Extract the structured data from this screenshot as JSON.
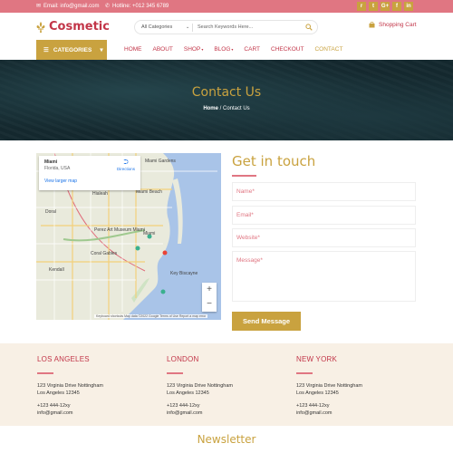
{
  "topbar": {
    "email": "Email: info@gmail.com",
    "hotline": "Hotline: +012 345 6789",
    "social_icons": [
      "rss-icon",
      "twitter-icon",
      "google-plus-icon",
      "facebook-icon",
      "linkedin-icon"
    ],
    "social_glyphs": [
      "r",
      "t",
      "G+",
      "f",
      "in"
    ]
  },
  "brand": {
    "name": "Cosmetic"
  },
  "search": {
    "category": "All Categories",
    "placeholder": "Search Keywords Here..."
  },
  "cart": {
    "label": "Shopping Cart"
  },
  "categories_button": {
    "label": "CATEGORIES"
  },
  "nav": {
    "home": "HOME",
    "about": "ABOUT",
    "shop": "SHOP",
    "blog": "BLOG",
    "cart": "CART",
    "checkout": "CHECKOUT",
    "contact": "CONTACT"
  },
  "hero": {
    "title": "Contact Us",
    "crumb_home": "Home",
    "crumb_sep": "/",
    "crumb_current": "Contact Us"
  },
  "map": {
    "place_name": "Miami",
    "place_sub": "Florida, USA",
    "view_larger": "View larger map",
    "directions": "Directions",
    "zoom_in": "+",
    "zoom_out": "−",
    "footer": "Keyboard shortcuts   Map data ©2022 Google   Terms of Use   Report a map error",
    "labels": [
      "Hialeah",
      "Miami Beach",
      "Miami",
      "Coral Gables",
      "Perez Art Museum Miami",
      "Key Biscayne",
      "Miami Gardens",
      "Doral",
      "Kendall"
    ]
  },
  "contact_form": {
    "title": "Get in touch",
    "name_placeholder": "Name*",
    "email_placeholder": "Email*",
    "website_placeholder": "Website*",
    "message_placeholder": "Message*",
    "send_label": "Send Message"
  },
  "offices": [
    {
      "city": "LOS ANGELES",
      "address1": "123 Virginia Drive Nottingham",
      "address2": "Los Angeles 12345",
      "phone": "+123 444-12xy",
      "email": "info@gmail.com"
    },
    {
      "city": "LONDON",
      "address1": "123 Virginia Drive Nottingham",
      "address2": "Los Angeles 12345",
      "phone": "+123 444-12xy",
      "email": "info@gmail.com"
    },
    {
      "city": "NEW YORK",
      "address1": "123 Virginia Drive Nottingham",
      "address2": "Los Angeles 12345",
      "phone": "+123 444-12xy",
      "email": "info@gmail.com"
    }
  ],
  "newsletter": {
    "title": "Newsletter"
  },
  "colors": {
    "primary": "#c23548",
    "accent_gold": "#c9a23f",
    "topbar_pink": "#e07682",
    "offices_bg": "#f8f0e5"
  }
}
